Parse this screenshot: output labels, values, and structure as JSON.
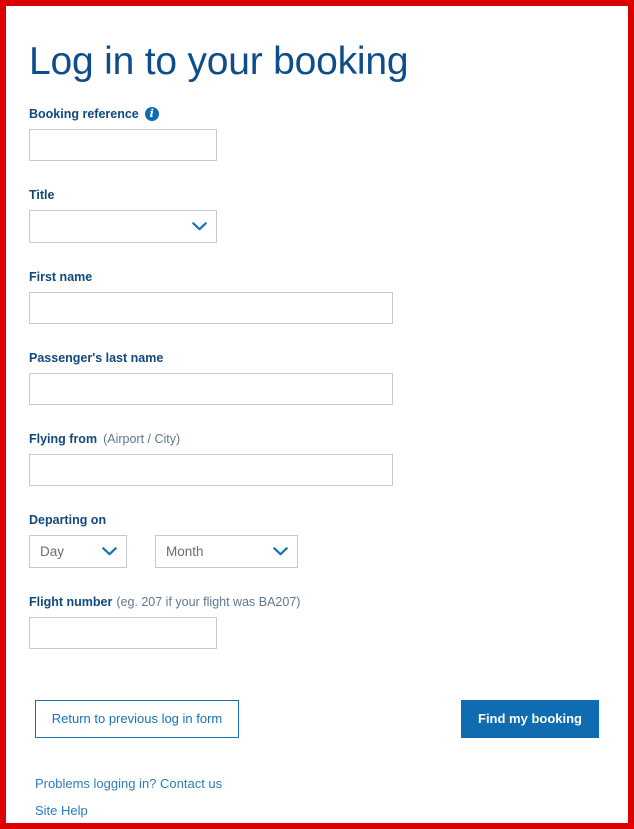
{
  "page": {
    "title": "Log in to your booking",
    "accent_blue": "#0f6cb0",
    "heading_blue": "#0e4d8c",
    "border_red": "#dc0000",
    "link_blue": "#2b7dc0",
    "input_border": "#c9c9c9"
  },
  "form": {
    "booking_reference": {
      "label": "Booking reference",
      "info_icon": "info-icon",
      "value": "",
      "placeholder": ""
    },
    "title": {
      "label": "Title",
      "value": "",
      "chevron_icon": "chevron-down-icon"
    },
    "first_name": {
      "label": "First name",
      "value": "",
      "placeholder": ""
    },
    "last_name": {
      "label": "Passenger's last name",
      "value": "",
      "placeholder": ""
    },
    "flying_from": {
      "label": "Flying from",
      "hint": "(Airport / City)",
      "value": "",
      "placeholder": ""
    },
    "departing_on": {
      "label": "Departing on",
      "day": {
        "value": "Day",
        "chevron_icon": "chevron-down-icon"
      },
      "month": {
        "value": "Month",
        "chevron_icon": "chevron-down-icon"
      }
    },
    "flight_number": {
      "label": "Flight number",
      "hint": "(eg. 207 if your flight was BA207)",
      "value": "",
      "placeholder": ""
    }
  },
  "actions": {
    "return_label": "Return to previous log in form",
    "find_label": "Find my booking"
  },
  "footer": {
    "contact_link": "Problems logging in? Contact us",
    "site_help_link": "Site Help"
  }
}
